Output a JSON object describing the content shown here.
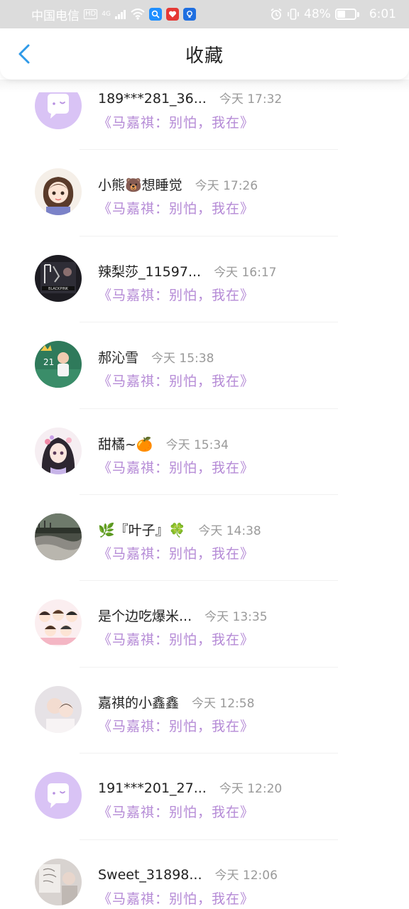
{
  "status_bar": {
    "carrier": "中国电信",
    "hd": "HD",
    "net": "4G",
    "battery": "48%",
    "battery_level": 0.48,
    "time": "6:01"
  },
  "header": {
    "title": "收藏"
  },
  "items": [
    {
      "name": "189***281_36...",
      "time": "今天 17:32",
      "subtitle": "《马嘉祺：别怕，我在》",
      "avatar": "default-chat-avatar"
    },
    {
      "name": "小熊🐻想睡觉",
      "time": "今天 17:26",
      "subtitle": "《马嘉祺：别怕，我在》",
      "avatar": "anime-girl-avatar"
    },
    {
      "name": "辣梨莎_11597...",
      "time": "今天 16:17",
      "subtitle": "《马嘉祺：别怕，我在》",
      "avatar": "dark-poster-avatar"
    },
    {
      "name": "郝沁雪",
      "time": "今天 15:38",
      "subtitle": "《马嘉祺：别怕，我在》",
      "avatar": "green-photo-avatar"
    },
    {
      "name": "甜橘~🍊",
      "time": "今天 15:34",
      "subtitle": "《马嘉祺：别怕，我在》",
      "avatar": "anime-princess-avatar"
    },
    {
      "name": "🌿『叶子』🍀",
      "time": "今天 14:38",
      "subtitle": "《马嘉祺：别怕，我在》",
      "avatar": "landscape-avatar"
    },
    {
      "name": "是个边吃爆米...",
      "time": "今天 13:35",
      "subtitle": "《马嘉祺：别怕，我在》",
      "avatar": "cartoon-group-avatar"
    },
    {
      "name": "嘉祺的小鑫鑫",
      "time": "今天 12:58",
      "subtitle": "《马嘉祺：别怕，我在》",
      "avatar": "portrait-photo-avatar"
    },
    {
      "name": "191***201_27...",
      "time": "今天 12:20",
      "subtitle": "《马嘉祺：别怕，我在》",
      "avatar": "default-chat-avatar"
    },
    {
      "name": "Sweet_31898...",
      "time": "今天 12:06",
      "subtitle": "《马嘉祺：别怕，我在》",
      "avatar": "sketch-photo-avatar"
    }
  ]
}
